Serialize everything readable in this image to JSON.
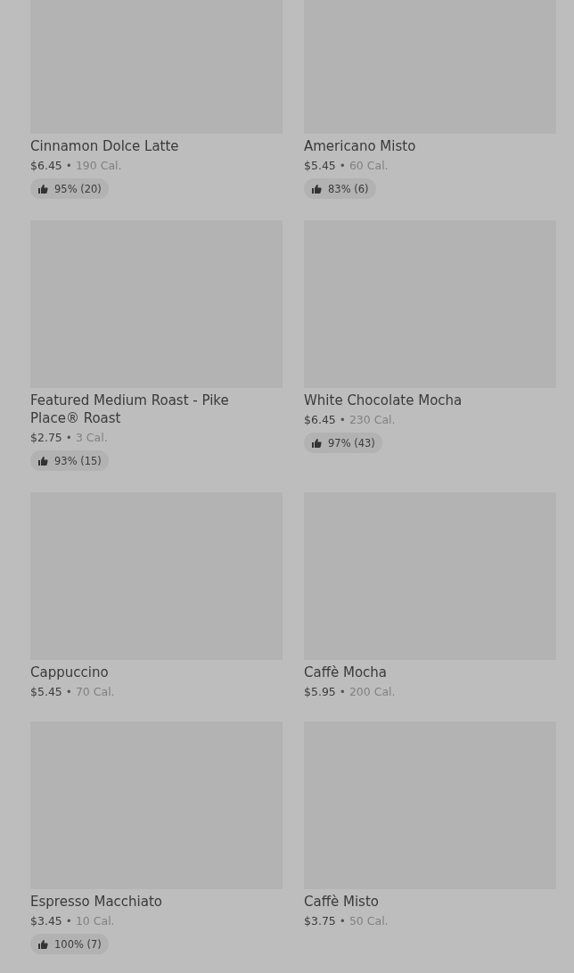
{
  "products": [
    {
      "name": "Cinnamon Dolce Latte",
      "price": "$6.45",
      "separator": "•",
      "calories": "190 Cal.",
      "rating": "95% (20)"
    },
    {
      "name": "Americano Misto",
      "price": "$5.45",
      "separator": "•",
      "calories": "60 Cal.",
      "rating": "83% (6)"
    },
    {
      "name": "Featured Medium Roast - Pike Place® Roast",
      "price": "$2.75",
      "separator": "•",
      "calories": "3 Cal.",
      "rating": "93% (15)"
    },
    {
      "name": "White Chocolate Mocha",
      "price": "$6.45",
      "separator": "•",
      "calories": "230 Cal.",
      "rating": "97% (43)"
    },
    {
      "name": "Cappuccino",
      "price": "$5.45",
      "separator": "•",
      "calories": "70 Cal."
    },
    {
      "name": "Caffè Mocha",
      "price": "$5.95",
      "separator": "•",
      "calories": "200 Cal."
    },
    {
      "name": "Espresso Macchiato",
      "price": "$3.45",
      "separator": "•",
      "calories": "10 Cal.",
      "rating": "100% (7)"
    },
    {
      "name": "Caffè Misto",
      "price": "$3.75",
      "separator": "•",
      "calories": "50 Cal."
    }
  ]
}
